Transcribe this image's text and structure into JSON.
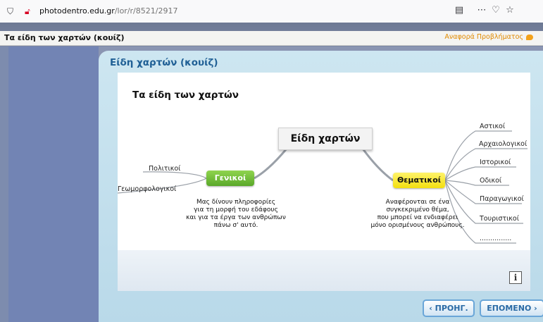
{
  "browser": {
    "url_host": "photodentro.edu.gr",
    "url_path": "/lor/r/8521/2917",
    "icons": [
      "shield-icon",
      "insecure-lock-icon",
      "reader-view-icon",
      "page-actions-icon",
      "pocket-icon",
      "bookmark-star-icon"
    ]
  },
  "header": {
    "title": "Τα είδη των χαρτών (κουίζ)",
    "report_link": "Αναφορά Προβλήματος"
  },
  "main": {
    "title": "Είδη χαρτών (κουίζ)",
    "card_heading": "Τα είδη των χαρτών"
  },
  "diagram": {
    "center": "Είδη χαρτών",
    "left_node": "Γενικοί",
    "left_leaves": [
      "Πολιτικοί",
      "Γεωμορφολογικοί"
    ],
    "left_description": [
      "Μας δίνουν πληροφορίες",
      "για τη μορφή του εδάφους",
      "και για τα έργα των ανθρώπων",
      "πάνω σ' αυτό."
    ],
    "right_node": "Θεματικοί",
    "right_leaves": [
      "Αστικοί",
      "Αρχαιολογικοί",
      "Ιστορικοί",
      "Οδικοί",
      "Παραγωγικοί",
      "Τουριστικοί",
      "..............."
    ],
    "right_description": [
      "Αναφέρονται σε ένα",
      "συγκεκριμένο θέμα,",
      "που μπορεί να ενδιαφέρει",
      "μόνο ορισμένους ανθρώπους."
    ]
  },
  "nav": {
    "prev_label": "‹ ΠΡΟΗΓ.",
    "next_label": "ΕΠΟΜΕΝΟ ›",
    "info_label": "i"
  },
  "colors": {
    "accent_blue": "#1f5f95",
    "left_node_green": "#5aa82a",
    "right_node_yellow": "#f3df10",
    "report_orange": "#e08a00"
  }
}
